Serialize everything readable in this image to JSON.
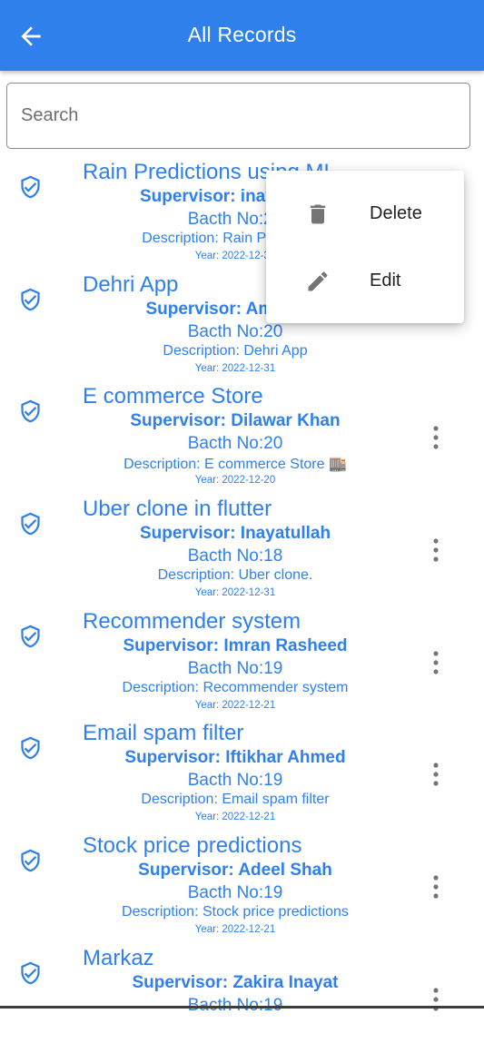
{
  "app_bar": {
    "title": "All Records",
    "back_icon": "arrow-back-icon",
    "background": "#2f80ed"
  },
  "search": {
    "placeholder": "Search",
    "value": ""
  },
  "accent_color": "#2f80ed",
  "records": [
    {
      "title": "Rain Predictions using ML",
      "supervisor": "Supervisor: inayatullah",
      "batch": "Bacth No:20",
      "description": "Description: Rain Predictions",
      "year": "Year: 2022-12-31"
    },
    {
      "title": "Dehri App",
      "supervisor": "Supervisor: Amjad Ali",
      "batch": "Bacth No:20",
      "description": "Description: Dehri App",
      "year": "Year: 2022-12-31"
    },
    {
      "title": "E commerce Store",
      "supervisor": "Supervisor: Dilawar Khan",
      "batch": "Bacth No:20",
      "description": "Description: E commerce Store 🏬",
      "year": "Year: 2022-12-20"
    },
    {
      "title": "Uber clone in flutter",
      "supervisor": "Supervisor: Inayatullah",
      "batch": "Bacth No:18",
      "description": "Description: Uber clone.",
      "year": "Year: 2022-12-31"
    },
    {
      "title": "Recommender system",
      "supervisor": "Supervisor: Imran Rasheed",
      "batch": "Bacth No:19",
      "description": "Description: Recommender system",
      "year": "Year: 2022-12-21"
    },
    {
      "title": "Email spam filter",
      "supervisor": "Supervisor: Iftikhar Ahmed",
      "batch": "Bacth No:19",
      "description": "Description: Email spam filter",
      "year": "Year: 2022-12-21"
    },
    {
      "title": "Stock price predictions",
      "supervisor": "Supervisor: Adeel Shah",
      "batch": "Bacth No:19",
      "description": "Description: Stock price predictions",
      "year": "Year: 2022-12-21"
    },
    {
      "title": "Markaz",
      "supervisor": "Supervisor: Zakira Inayat",
      "batch": "Bacth No:19",
      "description": "",
      "year": ""
    }
  ],
  "popup_menu": {
    "items": [
      {
        "label": "Delete",
        "icon": "delete-icon"
      },
      {
        "label": "Edit",
        "icon": "edit-icon"
      }
    ]
  }
}
